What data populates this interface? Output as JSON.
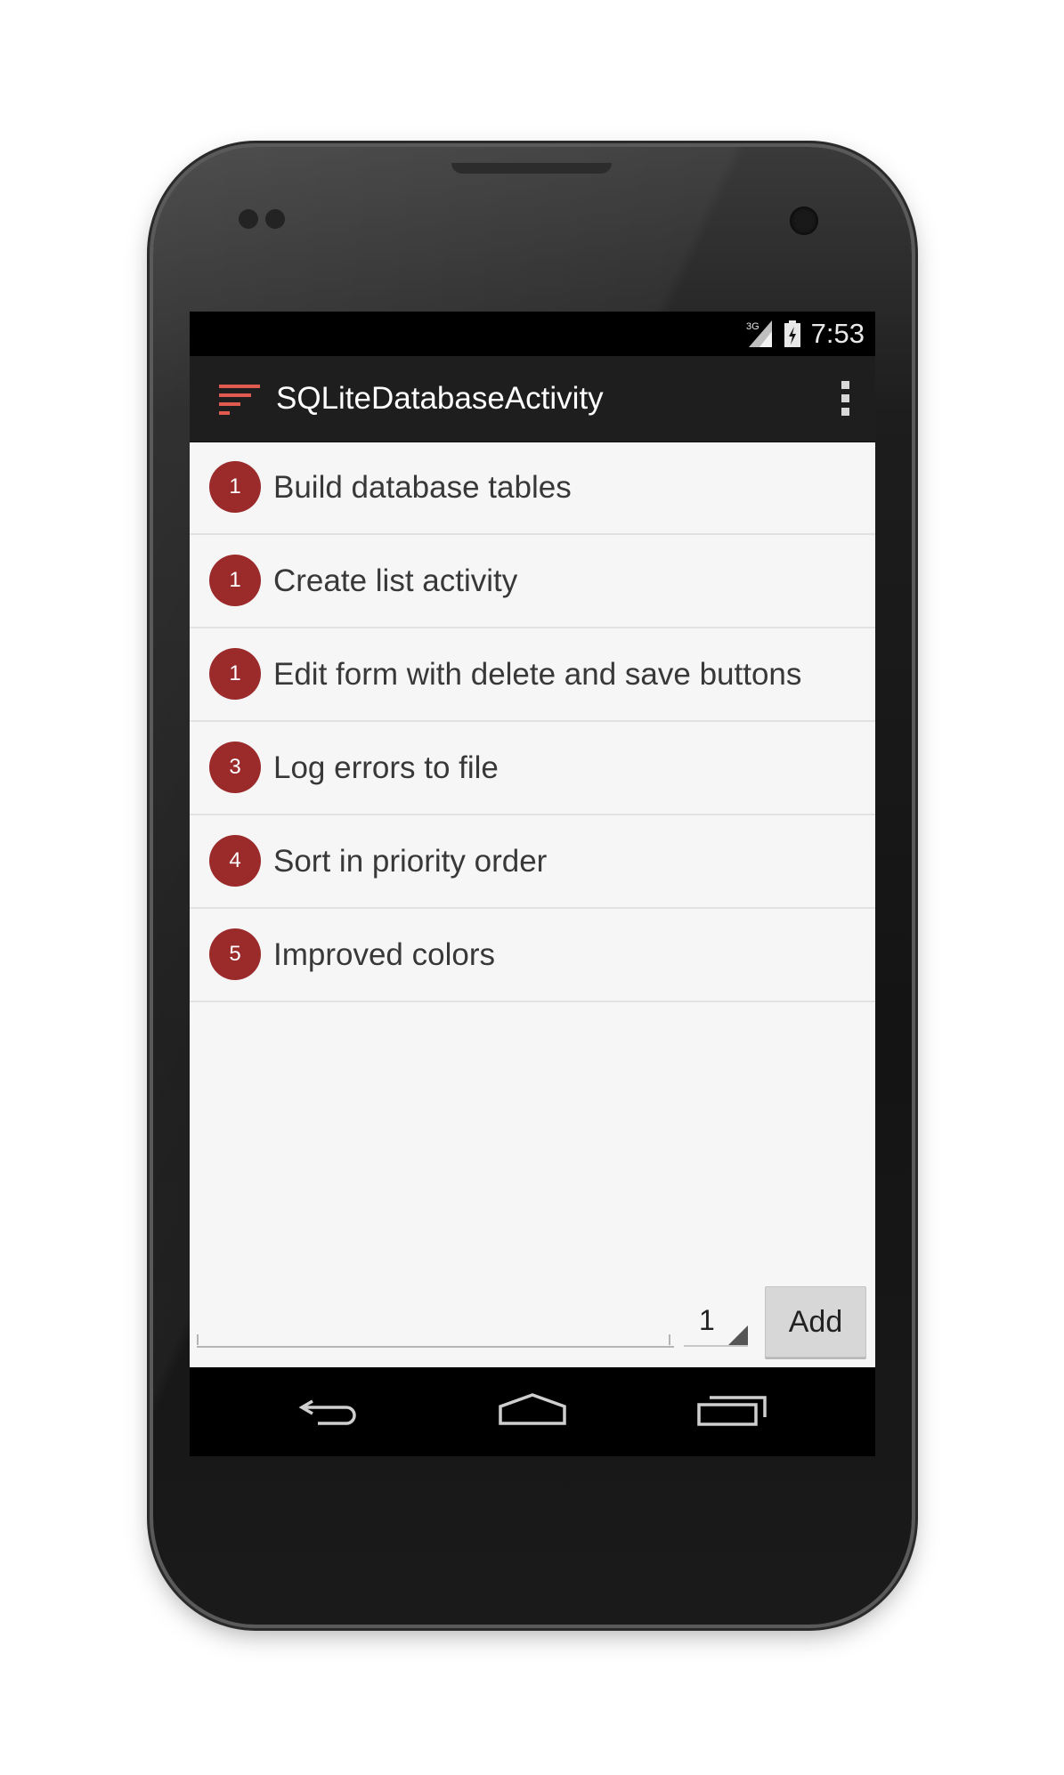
{
  "status_bar": {
    "network": "3G",
    "time": "7:53"
  },
  "action_bar": {
    "title": "SQLiteDatabaseActivity",
    "app_icon": "sort-lines-icon",
    "overflow_icon": "more-vert-icon"
  },
  "tasks": [
    {
      "priority": "1",
      "text": "Build database tables"
    },
    {
      "priority": "1",
      "text": "Create list activity"
    },
    {
      "priority": "1",
      "text": "Edit form with delete and save buttons"
    },
    {
      "priority": "3",
      "text": "Log errors to file"
    },
    {
      "priority": "4",
      "text": "Sort in priority order"
    },
    {
      "priority": "5",
      "text": "Improved colors"
    }
  ],
  "new_task": {
    "value": "",
    "priority": "1",
    "add_label": "Add"
  },
  "navigation": {
    "back": "back-icon",
    "home": "home-icon",
    "recents": "recents-icon"
  },
  "colors": {
    "accent": "#9b2b2b",
    "app_icon": "#e05a4f",
    "action_bar": "#1e1e1e",
    "list_background": "#f6f6f6"
  }
}
